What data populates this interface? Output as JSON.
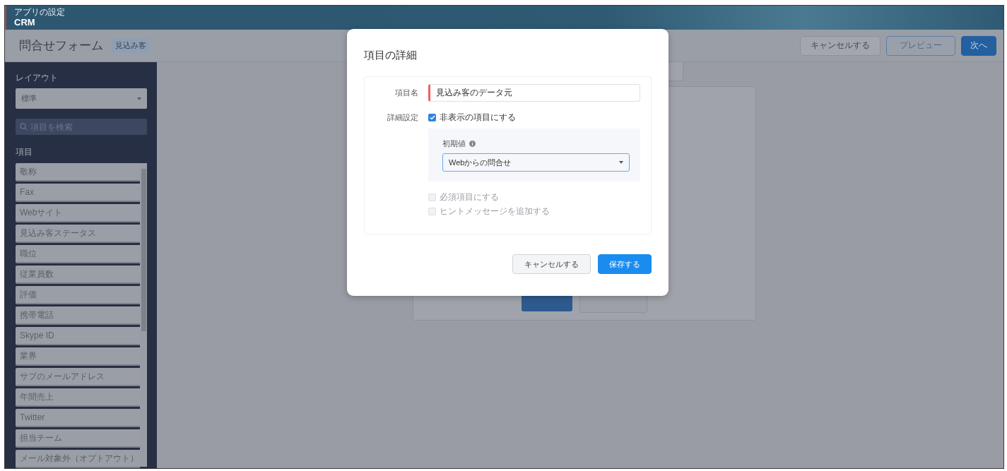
{
  "app": {
    "section": "アプリの設定",
    "name": "CRM"
  },
  "toolbar": {
    "title": "問合せフォーム",
    "badge": "見込み客",
    "buttons": [
      {
        "label": "キャンセルする",
        "kind": "secondary"
      },
      {
        "label": "プレビュー",
        "kind": "outline"
      },
      {
        "label": "次へ",
        "kind": "primary"
      }
    ]
  },
  "sidebar": {
    "layout_label": "レイアウト",
    "layout_select": "標準",
    "search": {
      "placeholder": "項目を検索"
    },
    "items_label": "項目",
    "items": [
      "敬称",
      "Fax",
      "Webサイト",
      "見込み客ステータス",
      "職位",
      "従業員数",
      "評価",
      "携帯電話",
      "Skype ID",
      "業界",
      "サブのメールアドレス",
      "年間売上",
      "Twitter",
      "担当チーム",
      "メール対象外（オプトアウト）"
    ]
  },
  "dialog": {
    "title": "項目の詳細",
    "name_label": "項目名",
    "name_value": "見込み客のデータ元",
    "settings_label": "詳細設定",
    "options": [
      {
        "label": "非表示の項目にする",
        "checked": true,
        "disabled": false
      },
      {
        "label": "必須項目にする",
        "checked": false,
        "disabled": true
      },
      {
        "label": "ヒントメッセージを追加する",
        "checked": false,
        "disabled": true
      }
    ],
    "default": {
      "label": "初期値",
      "value": "Webからの問合せ"
    },
    "buttons": [
      {
        "label": "キャンセルする",
        "kind": "secondary"
      },
      {
        "label": "保存する",
        "kind": "primary"
      }
    ]
  }
}
